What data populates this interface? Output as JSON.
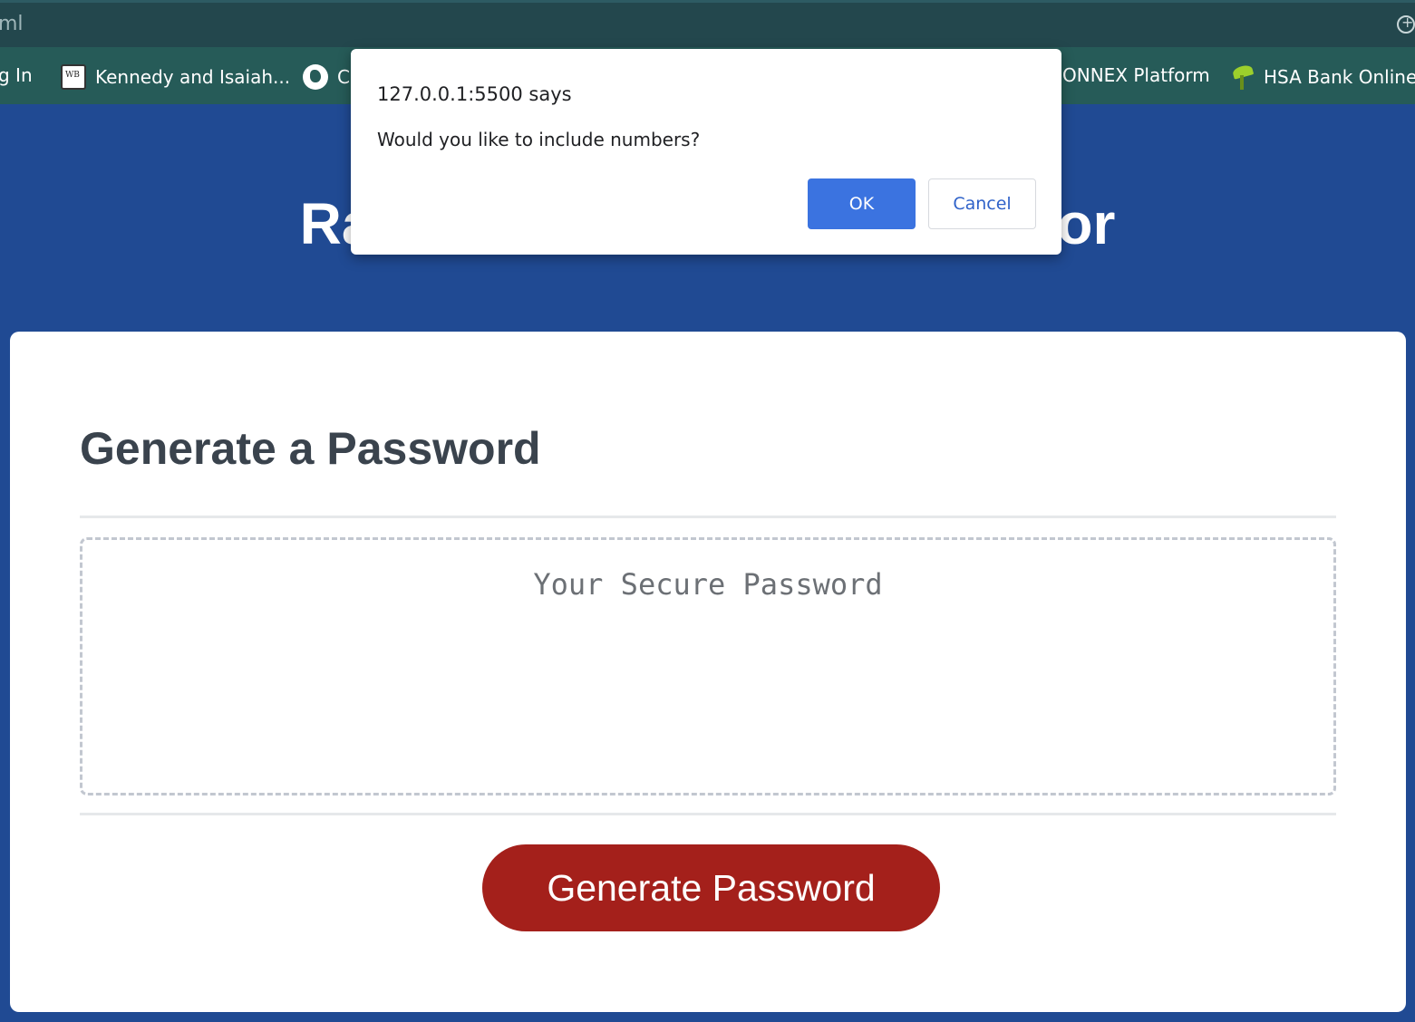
{
  "browser": {
    "url_fragment": "ml",
    "zoom_icon": "zoom-icon"
  },
  "bookmarks": {
    "items": [
      {
        "label": "g In",
        "icon": "none"
      },
      {
        "label": "Kennedy and Isaiah...",
        "icon": "wb-logo-icon"
      },
      {
        "label": "C",
        "icon": "globe-icon"
      },
      {
        "label": "ONNEX Platform",
        "icon": "none"
      },
      {
        "label": "HSA Bank Online",
        "icon": "palm-tree-icon"
      }
    ]
  },
  "page": {
    "title": "Random Password Generator",
    "card_title": "Generate a Password",
    "password_placeholder": "Your Secure Password",
    "generate_button": "Generate Password"
  },
  "dialog": {
    "origin": "127.0.0.1:5500 says",
    "message": "Would you like to include numbers?",
    "ok_label": "OK",
    "cancel_label": "Cancel"
  },
  "colors": {
    "page_background": "#204a93",
    "button_red": "#a4201b",
    "ok_blue": "#3b73e0"
  }
}
